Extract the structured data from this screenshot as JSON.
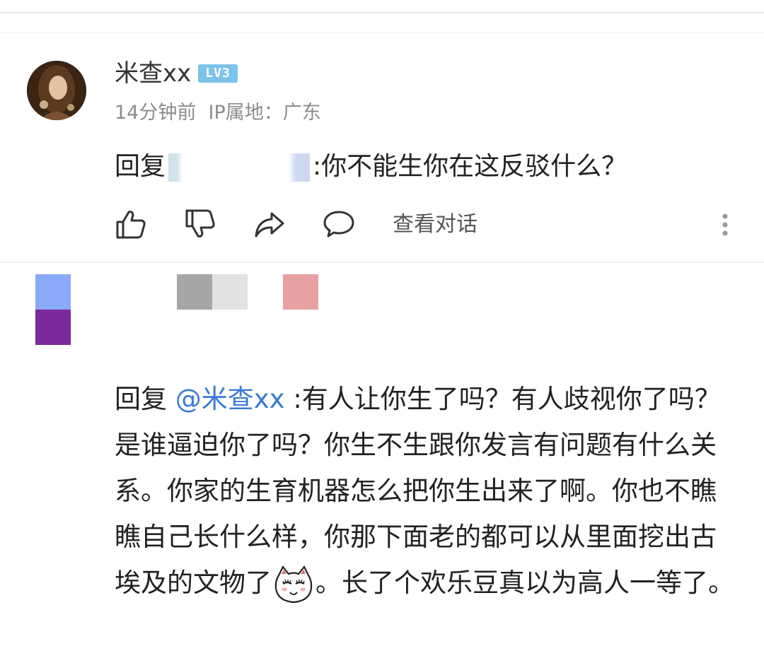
{
  "comment_1": {
    "username": "米查xx",
    "level_badge": "LV3",
    "time": "14分钟前",
    "ip_location": "IP属地：广东",
    "reply_prefix": "回复",
    "reply_text": ":你不能生你在这反驳什么？",
    "actions": {
      "like_icon": "thumbs-up-icon",
      "dislike_icon": "thumbs-down-icon",
      "share_icon": "share-icon",
      "comment_icon": "comment-icon",
      "view_conversation_label": "查看对话",
      "more_icon": "more-vertical-icon"
    }
  },
  "comment_2": {
    "reply_prefix": "回复",
    "mention": "@米查xx",
    "reply_text_part1": ":有人让你生了吗？有人歧视你了吗？是谁逼迫你了吗？你生不生跟你发言有问题有什么关系。你家的生育机器怎么把你生出来了啊。你也不瞧瞧自己长什么样，你那下面老的都可以从里面挖出古埃及的文物了",
    "emoji_icon": "cat-face-emoji-icon",
    "reply_text_part2": "。长了个欢乐豆真以为高人一等了。"
  },
  "colors": {
    "mention": "#3a7bd5",
    "level_badge": "#7cc3ea",
    "meta_text": "#8c8c8c"
  }
}
